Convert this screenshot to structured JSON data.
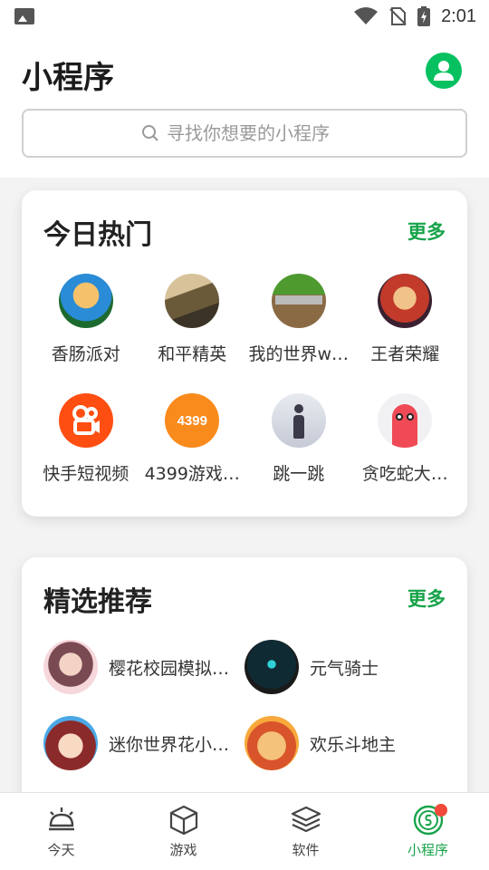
{
  "status_bar": {
    "time": "2:01"
  },
  "header": {
    "title": "小程序",
    "search_placeholder": "寻找你想要的小程序"
  },
  "hot": {
    "title": "今日热门",
    "more": "更多",
    "items": [
      {
        "label": "香肠派对",
        "icon": "sausage-party-icon"
      },
      {
        "label": "和平精英",
        "icon": "peace-elite-icon"
      },
      {
        "label": "我的世界w…",
        "icon": "minecraft-icon"
      },
      {
        "label": "王者荣耀",
        "icon": "honor-of-kings-icon"
      },
      {
        "label": "快手短视频",
        "icon": "kuaishou-icon"
      },
      {
        "label": "4399游戏…",
        "icon": "4399-icon",
        "icon_text": "4399"
      },
      {
        "label": "跳一跳",
        "icon": "jump-icon"
      },
      {
        "label": "贪吃蛇大…",
        "icon": "snake-icon"
      }
    ]
  },
  "recommend": {
    "title": "精选推荐",
    "more": "更多",
    "items": [
      {
        "label": "樱花校园模拟…",
        "icon": "sakura-school-icon"
      },
      {
        "label": "元气骑士",
        "icon": "soul-knight-icon"
      },
      {
        "label": "迷你世界花小…",
        "icon": "mini-world-icon"
      },
      {
        "label": "欢乐斗地主",
        "icon": "dou-dizhu-icon"
      }
    ]
  },
  "tabbar": {
    "tabs": [
      {
        "label": "今天",
        "icon": "bell-icon"
      },
      {
        "label": "游戏",
        "icon": "cube-icon"
      },
      {
        "label": "软件",
        "icon": "layers-icon"
      },
      {
        "label": "小程序",
        "icon": "mini-program-icon",
        "active": true
      }
    ]
  },
  "colors": {
    "accent": "#17a34a",
    "badge": "#f24a3a",
    "avatar": "#07c160"
  }
}
